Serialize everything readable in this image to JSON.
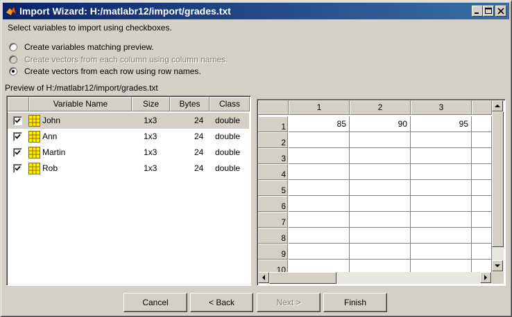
{
  "window": {
    "title": "Import Wizard: H:/matlabr12/import/grades.txt"
  },
  "instructions": "Select variables to import using checkboxes.",
  "options": [
    {
      "label": "Create variables matching preview.",
      "selected": false,
      "enabled": true
    },
    {
      "label": "Create vectors from each column using column names.",
      "selected": false,
      "enabled": false
    },
    {
      "label": "Create vectors from each row using row names.",
      "selected": true,
      "enabled": true
    }
  ],
  "preview_label": "Preview of H:/matlabr12/import/grades.txt",
  "variables_table": {
    "columns": [
      "Variable Name",
      "Size",
      "Bytes",
      "Class"
    ],
    "rows": [
      {
        "name": "John",
        "size": "1x3",
        "bytes": "24",
        "class": "double",
        "checked": true,
        "selected": true
      },
      {
        "name": "Ann",
        "size": "1x3",
        "bytes": "24",
        "class": "double",
        "checked": true,
        "selected": false
      },
      {
        "name": "Martin",
        "size": "1x3",
        "bytes": "24",
        "class": "double",
        "checked": true,
        "selected": false
      },
      {
        "name": "Rob",
        "size": "1x3",
        "bytes": "24",
        "class": "double",
        "checked": true,
        "selected": false
      }
    ]
  },
  "data_grid": {
    "column_headers": [
      "1",
      "2",
      "3"
    ],
    "row_headers": [
      "1",
      "2",
      "3",
      "4",
      "5",
      "6",
      "7",
      "8",
      "9",
      "10"
    ],
    "rows": [
      [
        "85",
        "90",
        "95"
      ],
      [
        "",
        "",
        ""
      ],
      [
        "",
        "",
        ""
      ],
      [
        "",
        "",
        ""
      ],
      [
        "",
        "",
        ""
      ],
      [
        "",
        "",
        ""
      ],
      [
        "",
        "",
        ""
      ],
      [
        "",
        "",
        ""
      ],
      [
        "",
        "",
        ""
      ],
      [
        "",
        "",
        ""
      ]
    ]
  },
  "buttons": {
    "cancel": "Cancel",
    "back": "< Back",
    "next": "Next >",
    "finish": "Finish"
  },
  "icons": {
    "app": "matlab-logo-icon",
    "variable": "array-grid-icon"
  },
  "colors": {
    "titlebar_start": "#0a246a",
    "titlebar_end": "#3a6ea5",
    "face": "#d4d0c8",
    "grid_icon_fill": "#ffee00"
  }
}
